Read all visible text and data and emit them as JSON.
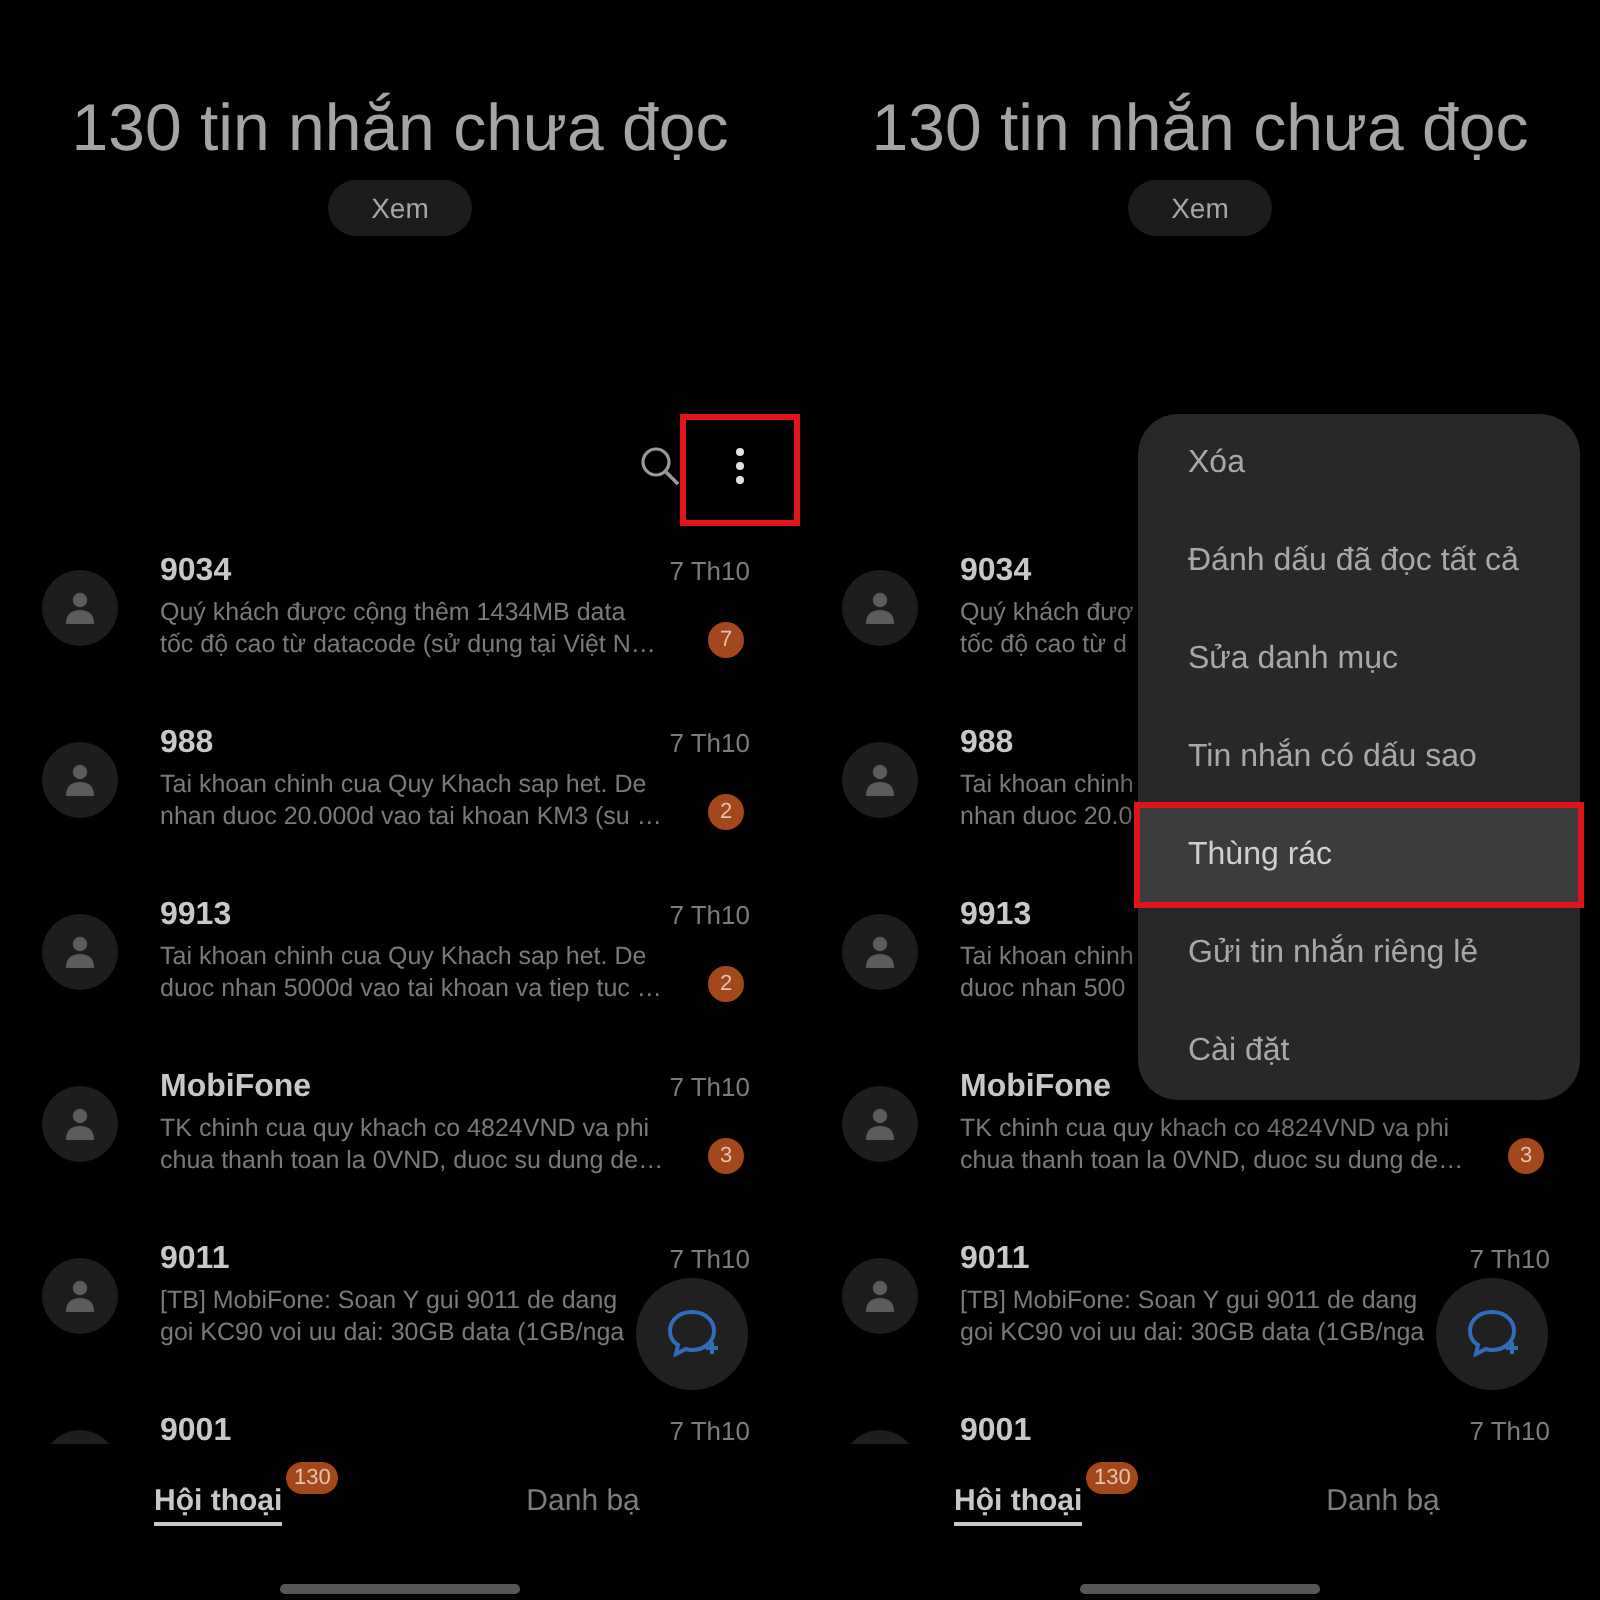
{
  "screens": [
    {
      "title": "130 tin nhắn chưa đọc",
      "view_button": "Xem",
      "toolbar": {
        "more_highlighted": true
      },
      "conversations": [
        {
          "name": "9034",
          "date": "7 Th10",
          "lines": [
            "Quý khách được cộng thêm 1434MB data",
            "tốc độ cao từ datacode (sử dụng tại Việt N…"
          ],
          "unread": "7"
        },
        {
          "name": "988",
          "date": "7 Th10",
          "lines": [
            "Tai khoan chinh cua Quy Khach sap het. De",
            "nhan duoc 20.000d vao tai khoan KM3 (su …"
          ],
          "unread": "2"
        },
        {
          "name": "9913",
          "date": "7 Th10",
          "lines": [
            "Tai khoan chinh cua Quy Khach sap het. De",
            "duoc nhan 5000d vao tai khoan va tiep tuc …"
          ],
          "unread": "2"
        },
        {
          "name": "MobiFone",
          "date": "7 Th10",
          "lines": [
            "TK chinh cua quy khach co 4824VND va phi",
            "chua thanh toan la 0VND, duoc su dung de…"
          ],
          "unread": "3"
        },
        {
          "name": "9011",
          "date": "7 Th10",
          "lines": [
            "[TB] MobiFone: Soan Y gui 9011 de dang",
            "goi KC90 voi uu dai: 30GB data (1GB/nga"
          ]
        },
        {
          "name": "9001",
          "date": "7 Th10"
        }
      ],
      "tabs": [
        {
          "label": "Hội thoại",
          "selected": true,
          "badge": "130"
        },
        {
          "label": "Danh bạ",
          "selected": false
        }
      ]
    },
    {
      "title": "130 tin nhắn chưa đọc",
      "view_button": "Xem",
      "conversations": [
        {
          "name": "9034",
          "lines": [
            "Quý khách đượ",
            "tốc độ cao từ d"
          ]
        },
        {
          "name": "988",
          "lines": [
            "Tai khoan chinh",
            "nhan duoc 20.0"
          ]
        },
        {
          "name": "9913",
          "lines": [
            "Tai khoan chinh",
            "duoc nhan 500"
          ]
        },
        {
          "name": "MobiFone",
          "lines": [
            "TK chinh cua quy khach co 4824VND va phi",
            "chua thanh toan la 0VND, duoc su dung de…"
          ],
          "unread": "3"
        },
        {
          "name": "9011",
          "date": "7 Th10",
          "lines": [
            "[TB] MobiFone: Soan Y gui 9011 de dang",
            "goi KC90 voi uu dai: 30GB data (1GB/nga"
          ]
        },
        {
          "name": "9001",
          "date": "7 Th10"
        }
      ],
      "tabs": [
        {
          "label": "Hội thoại",
          "selected": true,
          "badge": "130"
        },
        {
          "label": "Danh bạ",
          "selected": false
        }
      ],
      "menu": [
        {
          "label": "Xóa",
          "selected": false
        },
        {
          "label": "Đánh dấu đã đọc tất cả",
          "selected": false
        },
        {
          "label": "Sửa danh mục",
          "selected": false
        },
        {
          "label": "Tin nhắn có dấu sao",
          "selected": false
        },
        {
          "label": "Thùng rác",
          "selected": true
        },
        {
          "label": "Gửi tin nhắn riêng lẻ",
          "selected": false
        },
        {
          "label": "Cài đặt",
          "selected": false
        }
      ]
    }
  ]
}
